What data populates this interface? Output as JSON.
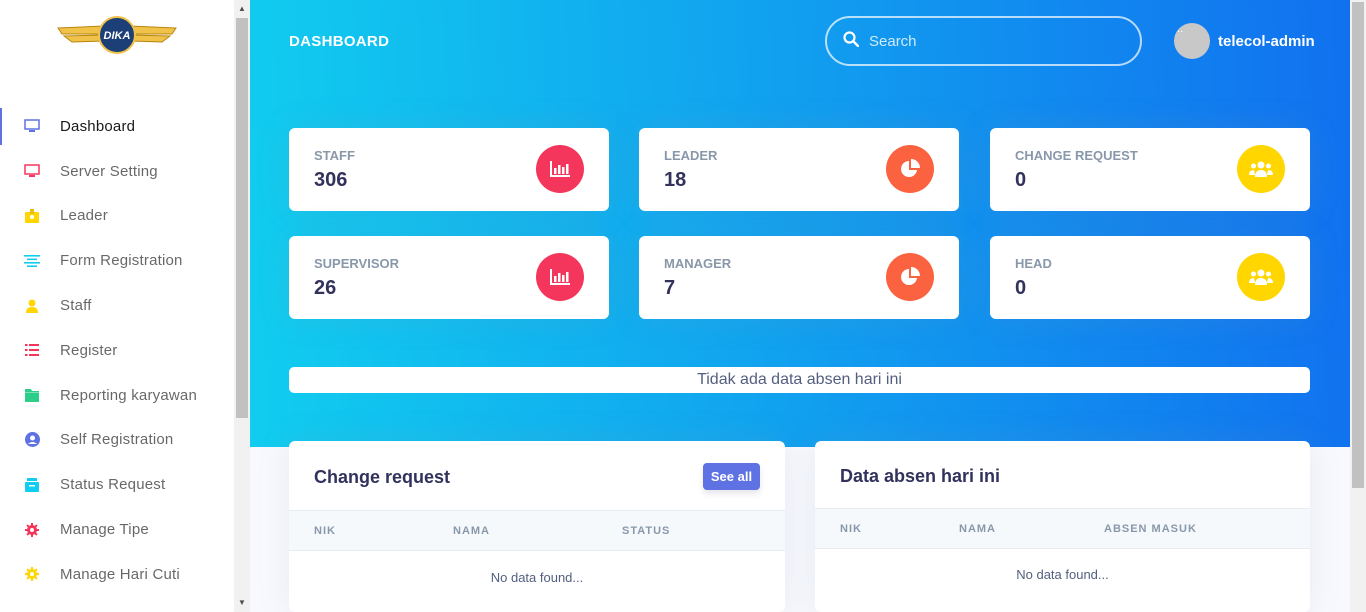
{
  "brand": {
    "logo_text": "DIKA"
  },
  "sidebar": {
    "items": [
      {
        "label": "Dashboard",
        "icon": "monitor-icon",
        "color": "#5e72e4"
      },
      {
        "label": "Server Setting",
        "icon": "monitor-icon",
        "color": "#f5365c"
      },
      {
        "label": "Leader",
        "icon": "badge-icon",
        "color": "#ffd600"
      },
      {
        "label": "Form Registration",
        "icon": "align-center-icon",
        "color": "#11cdef"
      },
      {
        "label": "Staff",
        "icon": "user-icon",
        "color": "#ffd600"
      },
      {
        "label": "Register",
        "icon": "bullet-list-icon",
        "color": "#f5365c"
      },
      {
        "label": "Reporting karyawan",
        "icon": "folder-icon",
        "color": "#2dce89"
      },
      {
        "label": "Self Registration",
        "icon": "user-circle-icon",
        "color": "#5e72e4"
      },
      {
        "label": "Status Request",
        "icon": "box-icon",
        "color": "#11cdef"
      },
      {
        "label": "Manage Tipe",
        "icon": "gear-icon",
        "color": "#f5365c"
      },
      {
        "label": "Manage Hari Cuti",
        "icon": "gear-icon",
        "color": "#ffd600"
      }
    ]
  },
  "header": {
    "title": "DASHBOARD",
    "search_placeholder": "Search",
    "username": "telecol-admin",
    "avatar_alt": "..."
  },
  "stats": [
    {
      "title": "STAFF",
      "value": "306",
      "icon": "bar-chart-icon",
      "color": "#f5365c"
    },
    {
      "title": "LEADER",
      "value": "18",
      "icon": "pie-chart-icon",
      "color": "#fb6340"
    },
    {
      "title": "CHANGE REQUEST",
      "value": "0",
      "icon": "users-icon",
      "color": "#ffd600"
    },
    {
      "title": "SUPERVISOR",
      "value": "26",
      "icon": "bar-chart-icon",
      "color": "#f5365c"
    },
    {
      "title": "MANAGER",
      "value": "7",
      "icon": "pie-chart-icon",
      "color": "#fb6340"
    },
    {
      "title": "HEAD",
      "value": "0",
      "icon": "users-icon",
      "color": "#ffd600"
    }
  ],
  "notice": "Tidak ada data absen hari ini",
  "change_request": {
    "title": "Change request",
    "see_all": "See all",
    "columns": [
      "NIK",
      "NAMA",
      "STATUS"
    ],
    "empty": "No data found..."
  },
  "absen": {
    "title": "Data absen hari ini",
    "columns": [
      "NIK",
      "NAMA",
      "ABSEN MASUK"
    ],
    "empty": "No data found..."
  }
}
